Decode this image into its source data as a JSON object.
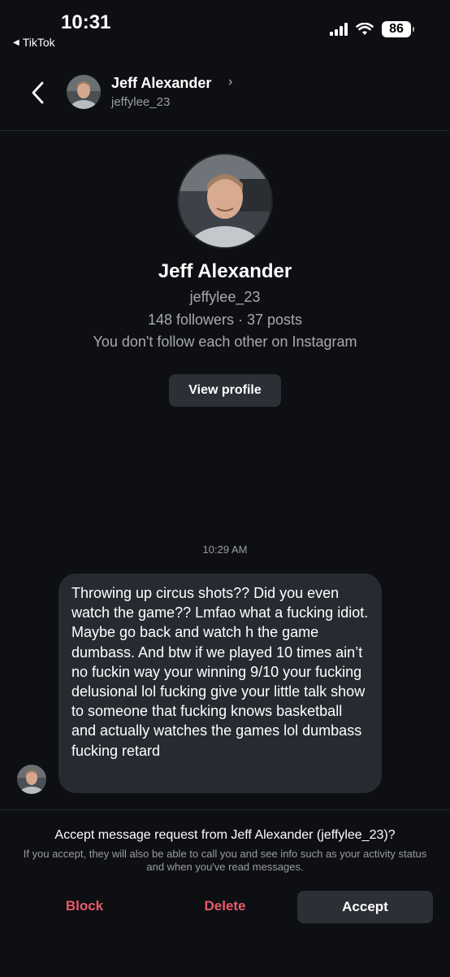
{
  "status_bar": {
    "time": "10:31",
    "back_app": "TikTok",
    "battery": "86"
  },
  "header": {
    "name": "Jeff Alexander",
    "username": "jeffylee_23"
  },
  "profile": {
    "name": "Jeff Alexander",
    "username": "jeffylee_23",
    "stats": "148 followers · 37 posts",
    "follow_status": "You don't follow each other on Instagram",
    "view_profile_label": "View profile"
  },
  "conversation": {
    "timestamp": "10:29 AM",
    "messages": [
      {
        "text": "Throwing up circus shots?? Did you even watch the game?? Lmfao what a fucking idiot. Maybe go back and watch h the game dumbass. And btw if we played 10 times ain’t no fuckin way your winning 9/10 your fucking delusional lol fucking give your little talk show to someone that fucking knows basketball and actually watches the games lol dumbass fucking retard"
      }
    ]
  },
  "request": {
    "title": "Accept message request from Jeff Alexander (jeffylee_23)?",
    "subtitle": "If you accept, they will also be able to call you and see info such as your activity status and when you've read messages.",
    "block_label": "Block",
    "delete_label": "Delete",
    "accept_label": "Accept"
  },
  "colors": {
    "background": "#0d0f13",
    "bubble": "#272a31",
    "destructive": "#ea5a6a",
    "button": "#2c2f36"
  },
  "icons": [
    "back-triangle-icon",
    "signal-icon",
    "wifi-icon",
    "battery-icon",
    "back-chevron-icon",
    "chevron-right-icon"
  ]
}
